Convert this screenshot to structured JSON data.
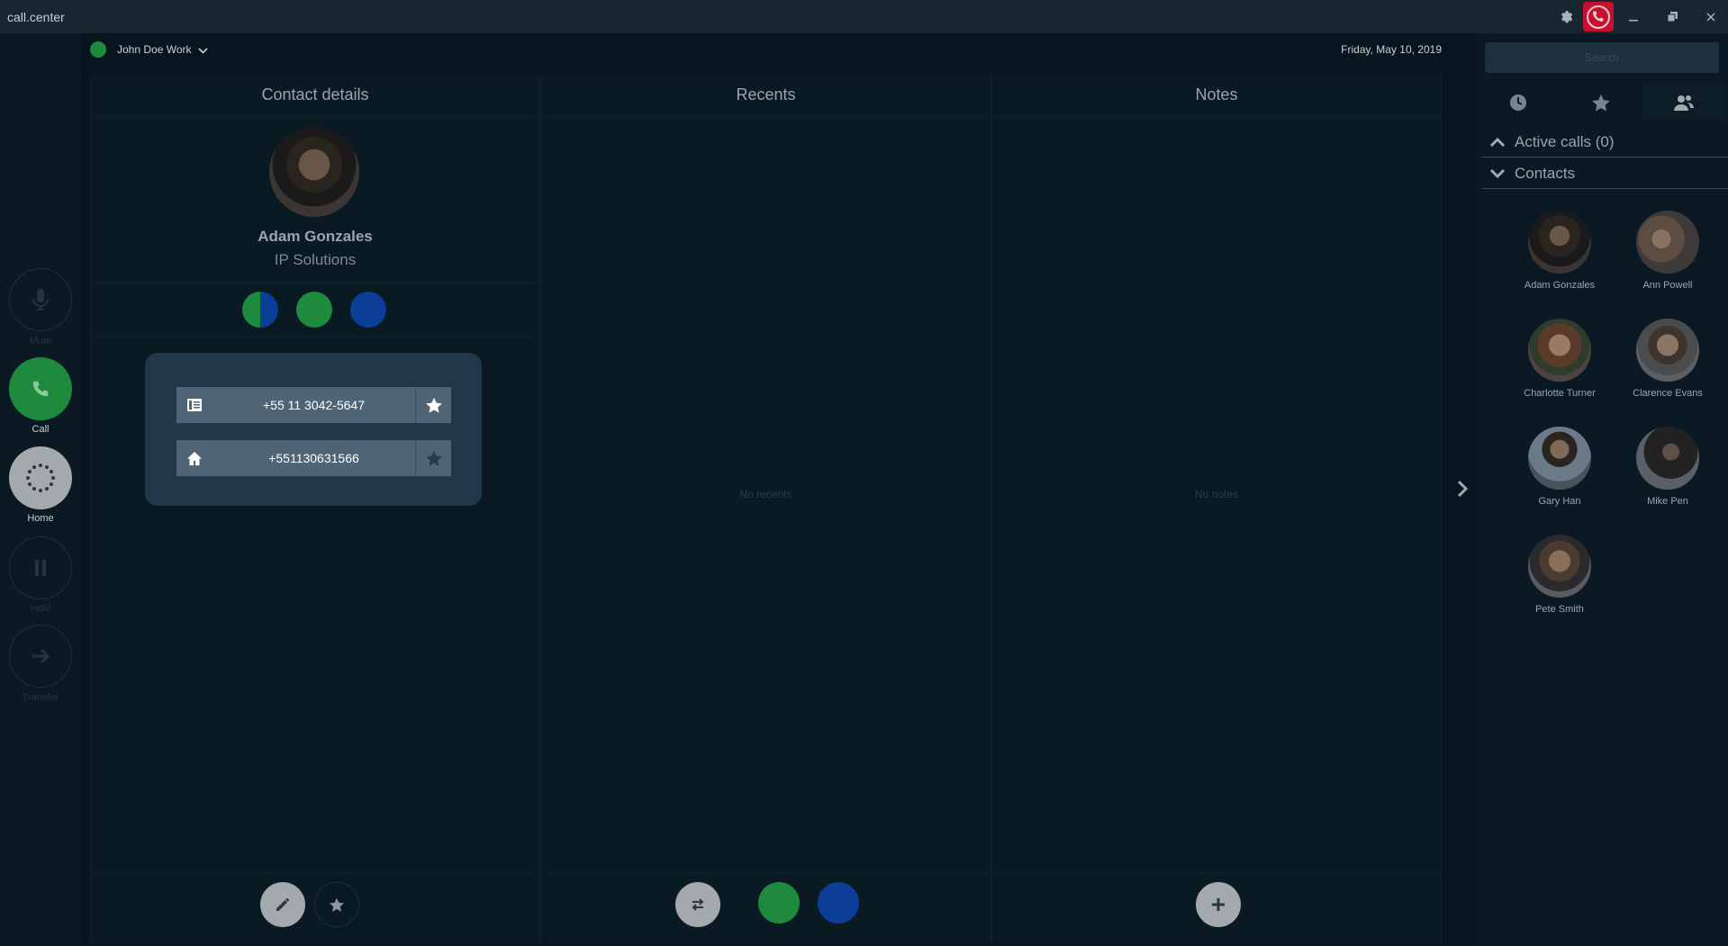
{
  "titlebar": {
    "app_title": "call.center"
  },
  "sidebar": [
    {
      "label": "Mute",
      "icon": "microphone-icon",
      "active": false
    },
    {
      "label": "Call",
      "icon": "phone-icon",
      "active": true,
      "color": "#1e8a3e"
    },
    {
      "label": "Home",
      "icon": "dial-ring-icon",
      "active": true,
      "color": "#a3a9ad"
    },
    {
      "label": "Hold",
      "icon": "pause-icon",
      "active": false
    },
    {
      "label": "Transfer",
      "icon": "arrow-right-icon",
      "active": false
    }
  ],
  "header": {
    "user": "John Doe Work",
    "date": "Friday, May 10, 2019",
    "status_color": "#1e8a3e"
  },
  "contact_panel": {
    "title": "Contact details",
    "name": "Adam Gonzales",
    "company": "IP Solutions",
    "numbers": [
      {
        "icon": "business-card-icon",
        "number": "+55 11 3042-5647",
        "favorite": true
      },
      {
        "icon": "home-icon",
        "number": "+551130631566",
        "favorite": false
      }
    ]
  },
  "recents_panel": {
    "title": "Recents",
    "empty": "No recents"
  },
  "notes_panel": {
    "title": "Notes",
    "empty": "No notes"
  },
  "right_panel": {
    "search_placeholder": "Search",
    "active_calls": "Active calls (0)",
    "contacts_label": "Contacts",
    "contacts": [
      {
        "name": "Adam Gonzales"
      },
      {
        "name": "Ann Powell"
      },
      {
        "name": "Charlotte Turner"
      },
      {
        "name": "Clarence Evans"
      },
      {
        "name": "Gary Han"
      },
      {
        "name": "Mike Pen"
      },
      {
        "name": "Pete Smith"
      }
    ]
  },
  "colors": {
    "green": "#1e8a3e",
    "blue": "#0b3e96",
    "accent_red": "#c8102e"
  }
}
